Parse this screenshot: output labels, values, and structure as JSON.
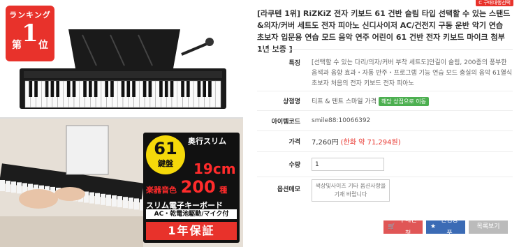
{
  "product_image": {
    "rank_top": "ランキング",
    "rank_no": "1",
    "rank_left": "第",
    "rank_right": "位",
    "keys_count": "61",
    "keys_unit": "鍵盤",
    "depth_label": "奥行スリム",
    "depth_value": "19cm",
    "tones_label": "楽器音色",
    "tones_value": "200",
    "tones_unit": "種",
    "product_type": "スリム電子キーボード",
    "features": "AC・乾電池駆動/マイク付",
    "warranty": "1年保証"
  },
  "corner_tag": "C 구매대행선택",
  "title": "[라쿠텐 1위] RiZKiZ 전자 키보드 61 건반 슬림 타입 선택할 수 있는 스탠드&의자/커버 세트도 전자 피아노 신디사이저 AC/건전지 구동 운반 악기 연습 초보자 입문용 연습 모드 음악 연주 어린이 61 건반 전자 키보드 마이크 첨부 1년 보증 ]",
  "details": {
    "feature_label": "특징",
    "feature_text": "[선택할 수 있는 다리/의자/커버 부착 세트도]안길이 슬림, 200종의 풍부한 음색과 음향 효과・자동 반주・프로그램 기능 연습 모드 충실의 음악 61열식 초보자 처음의 전자 키보드 전자 피아노",
    "seller_label": "상점명",
    "seller_name": "티프 & 텐트 스마일 가격",
    "seller_badge": "해당 상점으로 이동",
    "item_code_label": "아이템코드",
    "item_code": "smile88:10066392",
    "price_label": "가격",
    "price": "7,260円",
    "price_krw": "(한화 약 71,294원)",
    "qty_label": "수량",
    "qty_value": "1",
    "memo_label": "옵션메모",
    "memo_placeholder": "색상및사이즈 기타 옵션사항을 기재 바랍니다"
  },
  "buttons": {
    "buy": "구매신청",
    "favorite": "관심상품",
    "list": "목록보기"
  },
  "colors": {
    "accent_red": "#e8322b",
    "button_buy": "#e05656",
    "button_fav": "#3b6bb5",
    "button_list": "#bbbbbb",
    "seller_badge": "#4caf50",
    "overlay_yellow": "#f5d90a"
  },
  "icons": {
    "buy_icon": "cart-icon",
    "fav_icon": "star-icon"
  }
}
